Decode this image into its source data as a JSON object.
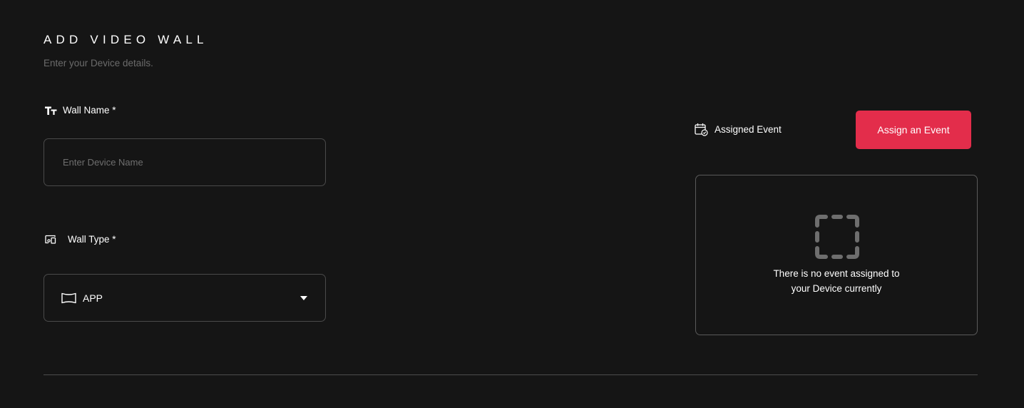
{
  "header": {
    "title": "ADD VIDEO WALL",
    "subtitle": "Enter your Device details."
  },
  "form": {
    "wall_name": {
      "label": "Wall Name *",
      "icon": "text-size-icon",
      "placeholder": "Enter Device Name",
      "value": ""
    },
    "wall_type": {
      "label": "Wall Type *",
      "icon": "devices-icon",
      "selected_value": "APP",
      "selected_icon": "screen-icon",
      "dropdown_icon": "caret-down-icon"
    }
  },
  "event": {
    "label": "Assigned Event",
    "icon": "calendar-check-icon",
    "assign_button_label": "Assign an Event",
    "empty_icon": "dashed-square-icon",
    "empty_message_line1": "There is no event assigned to",
    "empty_message_line2": "your Device currently"
  },
  "colors": {
    "background": "#151515",
    "accent": "#e32d4b",
    "muted_text": "#6b6b6b",
    "border": "#4a4a4a"
  }
}
